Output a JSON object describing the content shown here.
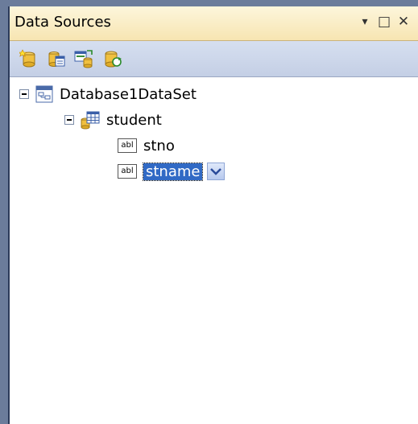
{
  "panel": {
    "title": "Data Sources",
    "window_buttons": {
      "dropdown": "▾",
      "maximize": "□",
      "close": "✕"
    }
  },
  "toolbar": {
    "items": [
      {
        "icon": "add-new-data-source-icon"
      },
      {
        "icon": "edit-dataset-designer-icon"
      },
      {
        "icon": "configure-dataset-wizard-icon"
      },
      {
        "icon": "refresh-icon"
      }
    ]
  },
  "tree": {
    "dataset": {
      "label": "Database1DataSet",
      "icon": "dataset-icon"
    },
    "table": {
      "label": "student",
      "icon": "table-icon"
    },
    "fields": [
      {
        "label": "stno",
        "icon": "textbox-abl-icon",
        "badge": "abl"
      },
      {
        "label": "stname",
        "icon": "textbox-abl-icon",
        "badge": "abl",
        "selected": true
      }
    ]
  }
}
